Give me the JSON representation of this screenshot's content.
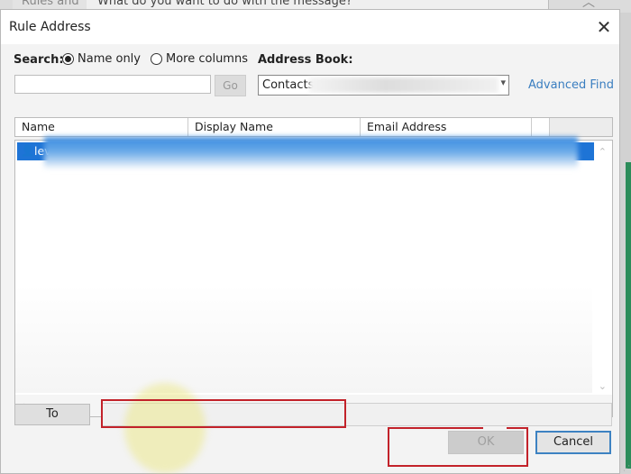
{
  "background_window": {
    "tab1": "Rules and",
    "tab2": "What do you want to do with the message?",
    "chevron_icon": "^"
  },
  "dialog": {
    "title": "Rule Address",
    "close_icon": "✕"
  },
  "search": {
    "label": "Search:",
    "options": [
      {
        "label": "Name only",
        "selected": true
      },
      {
        "label": "More columns",
        "selected": false
      }
    ],
    "input_value": "",
    "go_label": "Go"
  },
  "address_book": {
    "label": "Address Book:",
    "selected": "Contacts",
    "dropdown_icon": "▾",
    "advanced_find": "Advanced Find"
  },
  "list": {
    "columns": [
      "Name",
      "Display Name",
      "Email Address"
    ],
    "rows": [
      {
        "icon": "person-icon",
        "name": "lev",
        "selected": true
      }
    ],
    "scroll_up_icon": "⌃",
    "scroll_down_icon": "⌄",
    "scroll_left_icon": "‹",
    "scroll_right_icon": "›"
  },
  "recipient": {
    "to_label": "To",
    "value": ""
  },
  "buttons": {
    "ok": "OK",
    "cancel": "Cancel"
  },
  "colors": {
    "selection": "#1e74d6",
    "link": "#3a7ec0",
    "annotation_red": "#c2222a",
    "focus_border": "#3d82c2"
  }
}
